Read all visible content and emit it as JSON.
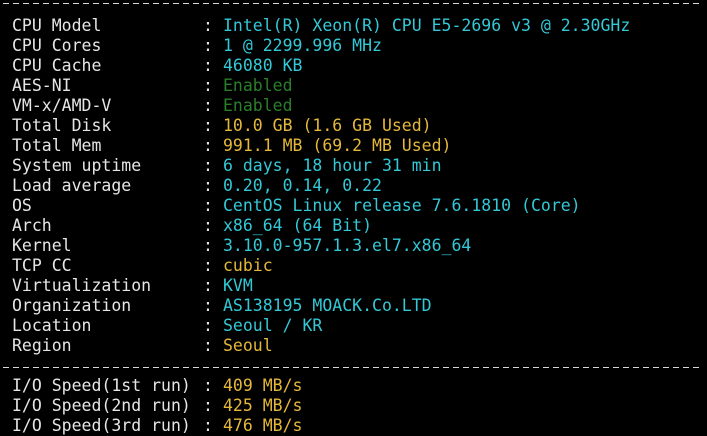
{
  "separator": "--------------------------------------------------------------------------",
  "rows": [
    {
      "label": "CPU Model",
      "value": "Intel(R) Xeon(R) CPU E5-2696 v3 @ 2.30GHz",
      "color": "#33c8d6"
    },
    {
      "label": "CPU Cores",
      "value": "1 @ 2299.996 MHz",
      "color": "#33c8d6"
    },
    {
      "label": "CPU Cache",
      "value": "46080 KB",
      "color": "#33c8d6"
    },
    {
      "label": "AES-NI",
      "value": "Enabled",
      "color": "#2a7f2a"
    },
    {
      "label": "VM-x/AMD-V",
      "value": "Enabled",
      "color": "#2a7f2a"
    },
    {
      "label": "Total Disk",
      "value": "10.0 GB (1.6 GB Used)",
      "color": "#e5b83a"
    },
    {
      "label": "Total Mem",
      "value": "991.1 MB (69.2 MB Used)",
      "color": "#e5b83a"
    },
    {
      "label": "System uptime",
      "value": "6 days, 18 hour 31 min",
      "color": "#33c8d6"
    },
    {
      "label": "Load average",
      "value": "0.20, 0.14, 0.22",
      "color": "#33c8d6"
    },
    {
      "label": "OS",
      "value": "CentOS Linux release 7.6.1810 (Core)",
      "color": "#33c8d6"
    },
    {
      "label": "Arch",
      "value": "x86_64 (64 Bit)",
      "color": "#33c8d6"
    },
    {
      "label": "Kernel",
      "value": "3.10.0-957.1.3.el7.x86_64",
      "color": "#33c8d6"
    },
    {
      "label": "TCP CC",
      "value": "cubic",
      "color": "#e5b83a"
    },
    {
      "label": "Virtualization",
      "value": "KVM",
      "color": "#33c8d6"
    },
    {
      "label": "Organization",
      "value": "AS138195 MOACK.Co.LTD",
      "color": "#33c8d6"
    },
    {
      "label": "Location",
      "value": "Seoul / KR",
      "color": "#33c8d6"
    },
    {
      "label": "Region",
      "value": "Seoul",
      "color": "#e5b83a"
    }
  ],
  "io_rows": [
    {
      "label": "I/O Speed(1st run)",
      "value": "409 MB/s",
      "color": "#e5b83a"
    },
    {
      "label": "I/O Speed(2nd run)",
      "value": "425 MB/s",
      "color": "#e5b83a"
    },
    {
      "label": "I/O Speed(3rd run)",
      "value": "476 MB/s",
      "color": "#e5b83a"
    }
  ],
  "colon": ":"
}
